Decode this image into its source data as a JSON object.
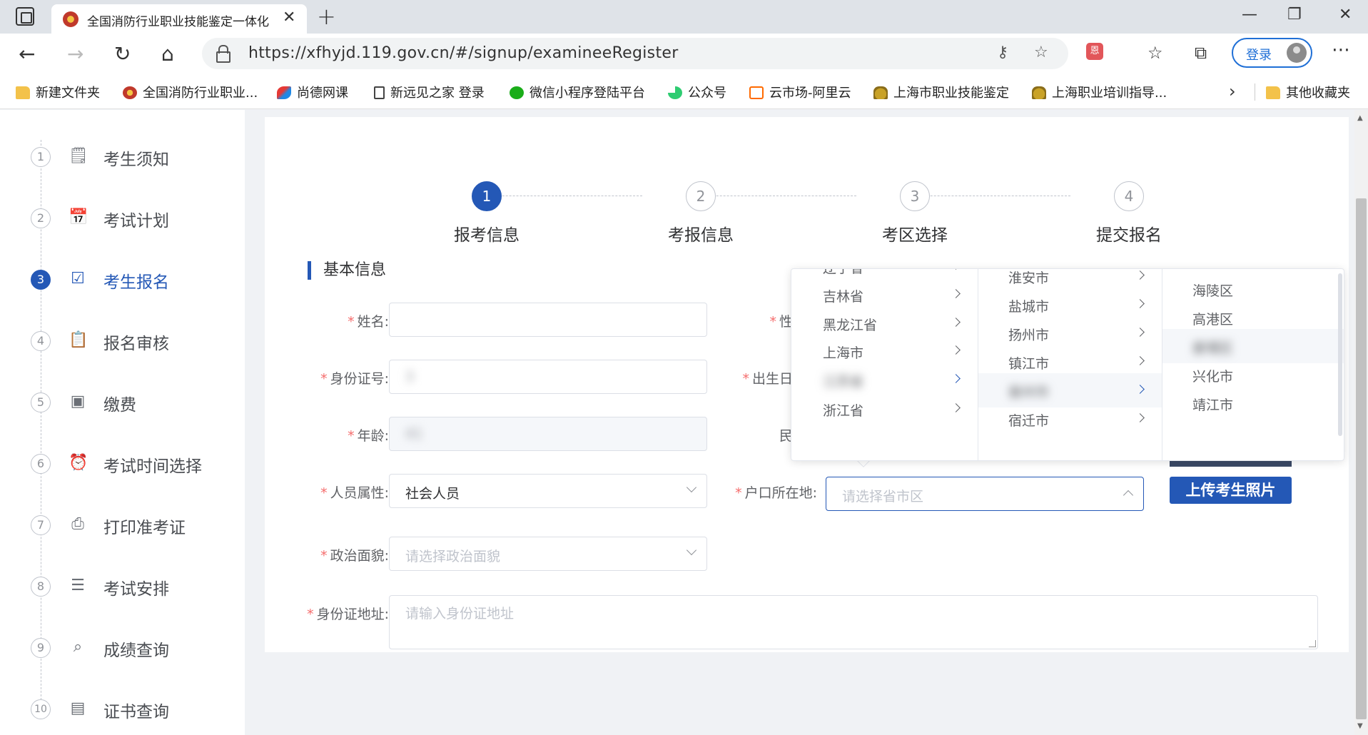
{
  "browser": {
    "tab_title": "全国消防行业职业技能鉴定一体化",
    "url": "https://xfhyjd.119.gov.cn/#/signup/examineeRegister",
    "login_label": "登录",
    "window_controls": [
      "minimize-icon",
      "restore-icon",
      "close-icon"
    ]
  },
  "bookmarks": [
    {
      "label": "新建文件夹",
      "icon": "folder-icon"
    },
    {
      "label": "全国消防行业职业...",
      "icon": "fire-emblem-icon"
    },
    {
      "label": "尚德网课",
      "icon": "bird-logo-icon"
    },
    {
      "label": "新远见之家 登录",
      "icon": "document-icon"
    },
    {
      "label": "微信小程序登陆平台",
      "icon": "wechat-icon"
    },
    {
      "label": "公众号",
      "icon": "wechat-public-icon"
    },
    {
      "label": "云市场-阿里云",
      "icon": "aliyun-icon"
    },
    {
      "label": "上海市职业技能鉴定",
      "icon": "gold-emblem-icon"
    },
    {
      "label": "上海职业培训指导...",
      "icon": "gold-emblem-icon"
    }
  ],
  "bookmarks_other": "其他收藏夹",
  "sidebar": {
    "items": [
      {
        "num": "1",
        "label": "考生须知",
        "icon": "notice-icon",
        "active": false
      },
      {
        "num": "2",
        "label": "考试计划",
        "icon": "plan-icon",
        "active": false
      },
      {
        "num": "3",
        "label": "考生报名",
        "icon": "register-icon",
        "active": true
      },
      {
        "num": "4",
        "label": "报名审核",
        "icon": "review-icon",
        "active": false
      },
      {
        "num": "5",
        "label": "缴费",
        "icon": "wallet-icon",
        "active": false
      },
      {
        "num": "6",
        "label": "考试时间选择",
        "icon": "alarm-clock-icon",
        "active": false
      },
      {
        "num": "7",
        "label": "打印准考证",
        "icon": "printer-icon",
        "active": false
      },
      {
        "num": "8",
        "label": "考试安排",
        "icon": "schedule-icon",
        "active": false
      },
      {
        "num": "9",
        "label": "成绩查询",
        "icon": "search-icon",
        "active": false
      },
      {
        "num": "10",
        "label": "证书查询",
        "icon": "certificate-icon",
        "active": false
      }
    ]
  },
  "steps": [
    {
      "num": "1",
      "label": "报考信息",
      "active": true
    },
    {
      "num": "2",
      "label": "考报信息",
      "active": false
    },
    {
      "num": "3",
      "label": "考区选择",
      "active": false
    },
    {
      "num": "4",
      "label": "提交报名",
      "active": false
    }
  ],
  "section_title": "基本信息",
  "form": {
    "name_label": "姓名:",
    "gender_label": "性",
    "id_label": "身份证号:",
    "id_value": "3",
    "birth_label": "出生日",
    "age_label": "年龄:",
    "age_value": "41",
    "ethnic_label": "民",
    "type_label": "人员属性:",
    "type_value": "社会人员",
    "hukou_label": "户口所在地:",
    "hukou_placeholder": "请选择省市区",
    "politics_label": "政治面貌:",
    "politics_placeholder": "请选择政治面貌",
    "address_label": "身份证地址:",
    "address_placeholder": "请输入身份证地址",
    "upload_label": "上传考生照片"
  },
  "cascader": {
    "provinces": [
      "辽宁省",
      "吉林省",
      "黑龙江省",
      "上海市",
      "江苏省",
      "浙江省"
    ],
    "cities": [
      "淮安市",
      "盐城市",
      "扬州市",
      "镇江市",
      "泰州市",
      "宿迁市"
    ],
    "districts": [
      "海陵区",
      "高港区",
      "姜堰区",
      "兴化市",
      "靖江市"
    ]
  },
  "colors": {
    "accent": "#2458b6",
    "required": "#f56c6c"
  }
}
